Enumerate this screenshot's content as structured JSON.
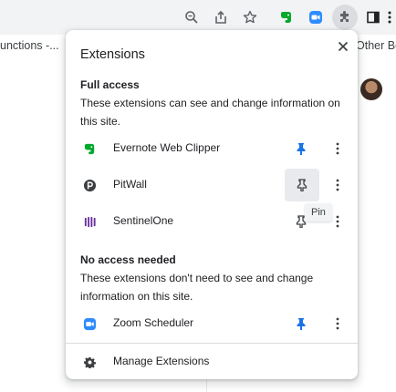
{
  "toolbar": {
    "icons": [
      "zoom-icon",
      "share-icon",
      "bookmark-star-icon",
      "evernote-icon",
      "zoom-scheduler-icon",
      "extensions-puzzle-icon",
      "side-panel-icon",
      "more-icon"
    ]
  },
  "background": {
    "bookmark_left": "unctions -...",
    "bookmark_right": "Other Bo"
  },
  "popup": {
    "title": "Extensions",
    "close_icon": "close-icon",
    "full_access": {
      "heading": "Full access",
      "description": "These extensions can see and change information on this site.",
      "items": [
        {
          "name": "Evernote Web Clipper",
          "icon": "evernote-icon",
          "pinned": true
        },
        {
          "name": "PitWall",
          "icon": "pitwall-icon",
          "pinned": false
        },
        {
          "name": "SentinelOne",
          "icon": "sentinelone-icon",
          "pinned": false
        }
      ]
    },
    "no_access": {
      "heading": "No access needed",
      "description": "These extensions don't need to see and change information on this site.",
      "items": [
        {
          "name": "Zoom Scheduler",
          "icon": "zoom-icon",
          "pinned": true
        }
      ]
    },
    "manage": {
      "label": "Manage Extensions",
      "icon": "gear-icon"
    },
    "tooltip": "Pin"
  },
  "colors": {
    "accent": "#1a73e8",
    "evernote": "#00a82d",
    "zoom": "#2d8cff",
    "sentinelone": "#6b2fa0",
    "toolbar_bg": "#f1f3f4"
  }
}
